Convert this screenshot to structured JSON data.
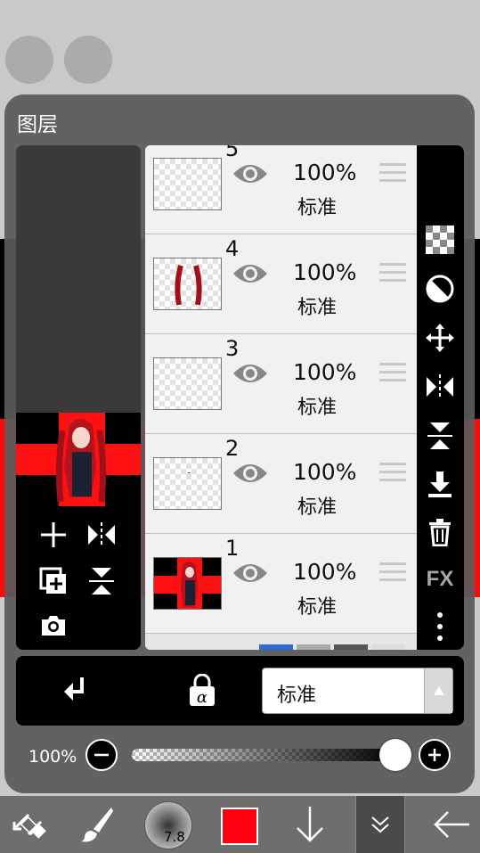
{
  "panel": {
    "title": "图层"
  },
  "layers": [
    {
      "number": "5",
      "opacity": "100%",
      "blend": "标准",
      "thumb": "empty"
    },
    {
      "number": "4",
      "opacity": "100%",
      "blend": "标准",
      "thumb": "red-strokes"
    },
    {
      "number": "3",
      "opacity": "100%",
      "blend": "标准",
      "thumb": "empty"
    },
    {
      "number": "2",
      "opacity": "100%",
      "blend": "标准",
      "thumb": "speck"
    },
    {
      "number": "1",
      "opacity": "100%",
      "blend": "标准",
      "thumb": "character"
    }
  ],
  "right_toolbar": {
    "items": [
      "checker-icon",
      "half-circle-icon",
      "move-icon",
      "flip-horizontal-icon",
      "flip-vertical-icon",
      "merge-down-icon",
      "trash-icon",
      "fx",
      "more-icon"
    ],
    "fx_label": "FX"
  },
  "preview_actions": [
    "add-layer-icon",
    "flip-horizontal-icon",
    "duplicate-layer-icon",
    "flip-vertical-icon",
    "camera-icon"
  ],
  "controls": {
    "blend_mode": "标准",
    "opacity_label": "100%",
    "opacity_value": 1.0
  },
  "bottom_toolbar": {
    "brush_size": "7.8",
    "color": "#ff0010",
    "items": [
      "transform-icon",
      "brush-icon",
      "brush-size",
      "color-swatch",
      "arrow-down-icon",
      "collapse-icon",
      "back-arrow-icon"
    ]
  },
  "colors": {
    "accent_red": "#ff0a0a",
    "panel_bg": "#5a5a5a"
  }
}
